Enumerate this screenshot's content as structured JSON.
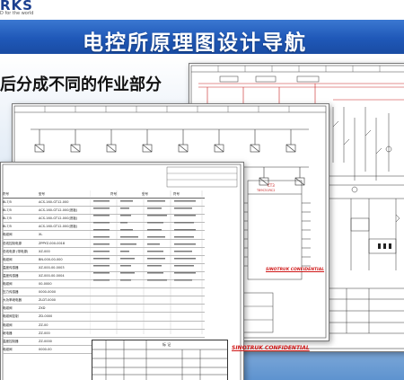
{
  "header": {
    "logo_text": "RKS",
    "logo_tagline": "D for the world",
    "title": "电控所原理图设计导航"
  },
  "subtitle": "后分成不同的作业部分",
  "sheets": {
    "ruler_numbers": [
      "1",
      "2",
      "3",
      "4",
      "5",
      "6",
      "7",
      "8",
      "9",
      "10"
    ],
    "ruler_numbers_back": [
      "1",
      "2",
      "3",
      "4",
      "5",
      "6",
      "7",
      "8"
    ],
    "ic_label": "CT3",
    "ic_sublabel": "T89C51RC2",
    "stamp_text": "SINOTRUK CONFIDENTIAL",
    "titleblock_text": "标 记",
    "table_headers": [
      "符号",
      "型号",
      "符号",
      "型号",
      "符号",
      "型号"
    ],
    "table_rows": [
      [
        "BL7/5",
        "ACS-160-GT12-000"
      ],
      [
        "BL7/5",
        "ACS-160-GT12-000(底板)"
      ],
      [
        "BL7/5",
        "ACS-160-GT12-000(底板)"
      ],
      [
        "BL7/5",
        "ACS-160-GT12-000(底板)"
      ],
      [
        "电磁阀",
        "XL"
      ],
      [
        "总线控制电源",
        "ZPPYZ-000-0018"
      ],
      [
        "总线电源 (带电源)",
        "XZ-000"
      ],
      [
        "电磁阀",
        "BN-000-00-000"
      ],
      [
        "温度传感器",
        "XZ-000-00-0003"
      ],
      [
        "温度传感器",
        "XZ-000-00-0004"
      ],
      [
        "电磁阀",
        "00-0000"
      ],
      [
        "压力传感器",
        "0000-0000"
      ],
      [
        "大功率继电器",
        "ZLDT-0000"
      ],
      [
        "电磁阀",
        "ZXD"
      ],
      [
        "电磁阀控制",
        "ZD-0000"
      ],
      [
        "电磁阀",
        "ZZ-00"
      ],
      [
        "继电器",
        "ZZ-000"
      ],
      [
        "温度控制器",
        "ZZ-0000"
      ],
      [
        "电磁阀",
        "0000-00"
      ]
    ]
  },
  "colors": {
    "banner": "#1f58b8",
    "stamp": "#d01818",
    "wire_red": "#c82020"
  }
}
